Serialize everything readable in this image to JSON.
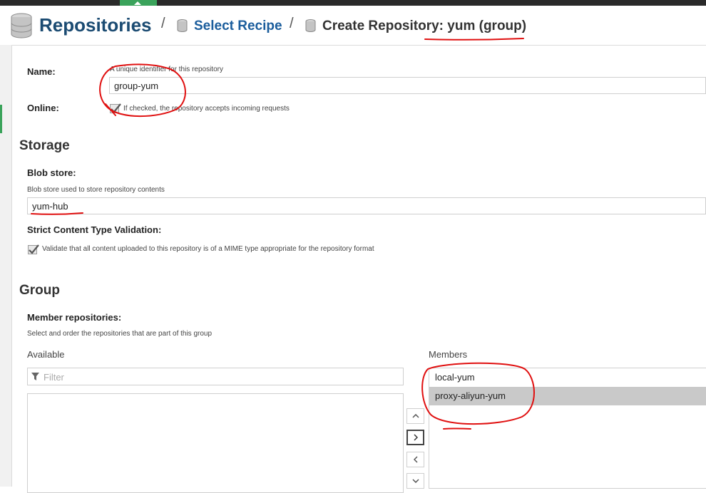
{
  "header": {
    "title": "Repositories",
    "separator": "/",
    "recipe_link": "Select Recipe",
    "create_title": "Create Repository: yum (group)"
  },
  "form": {
    "name_label": "Name:",
    "name_help": "A unique identifier for this repository",
    "name_value": "group-yum",
    "online_label": "Online:",
    "online_checked": true,
    "online_help": "If checked, the repository accepts incoming requests"
  },
  "storage": {
    "title": "Storage",
    "blob_label": "Blob store:",
    "blob_help": "Blob store used to store repository contents",
    "blob_value": "yum-hub",
    "strict_label": "Strict Content Type Validation:",
    "strict_checked": true,
    "strict_help": "Validate that all content uploaded to this repository is of a MIME type appropriate for the repository format"
  },
  "group": {
    "title": "Group",
    "members_label": "Member repositories:",
    "members_help": "Select and order the repositories that are part of this group",
    "available_title": "Available",
    "filter_placeholder": "Filter",
    "members_title": "Members",
    "members": [
      {
        "label": "local-yum",
        "selected": false
      },
      {
        "label": "proxy-aliyun-yum",
        "selected": true
      }
    ]
  },
  "colors": {
    "brand_blue": "#1b4b72",
    "link_blue": "#1b5d9c",
    "accent_green": "#3aa35b",
    "annotation_red": "#e01010"
  },
  "icons": [
    "database-icon",
    "filter-icon",
    "checkmark-icon",
    "chevron-up-icon",
    "chevron-right-icon",
    "chevron-left-icon",
    "chevron-down-icon"
  ]
}
